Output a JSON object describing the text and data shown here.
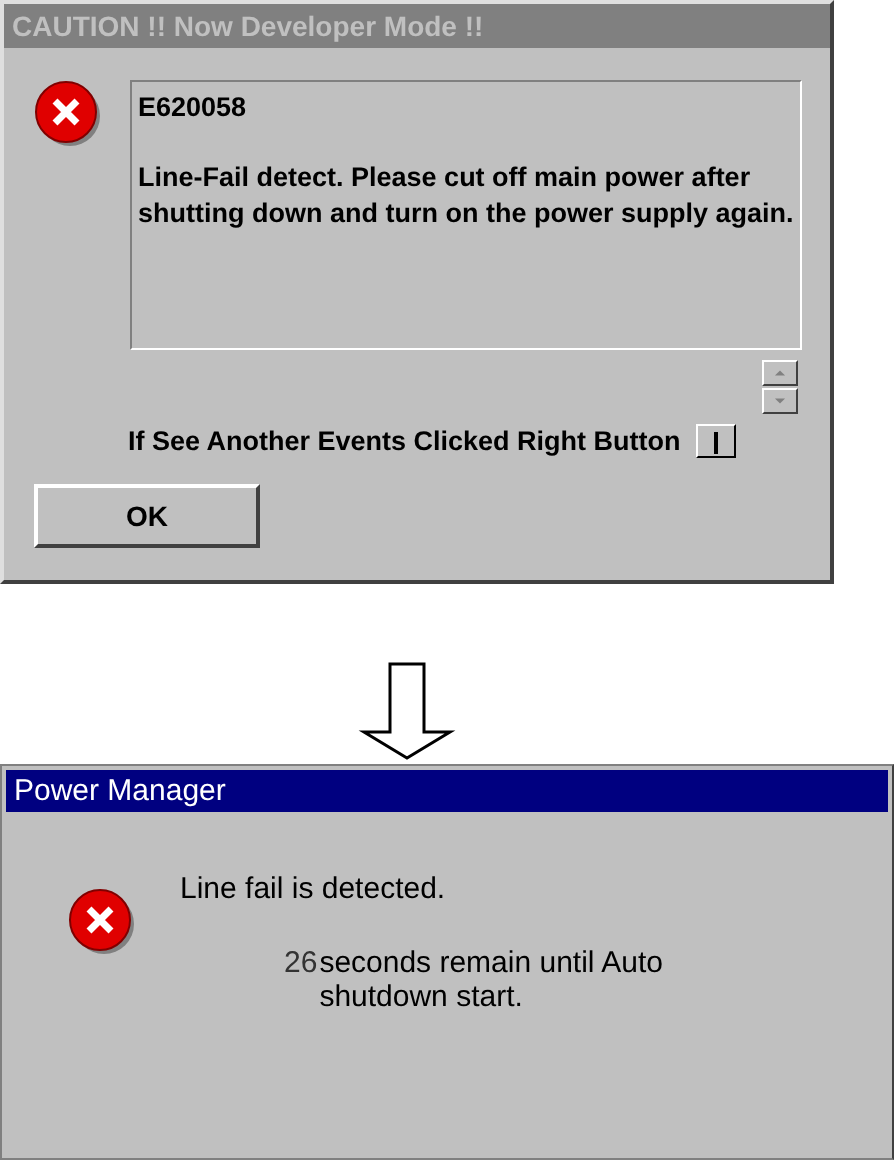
{
  "caution_dialog": {
    "title": "CAUTION !! Now Developer Mode !!",
    "active": false,
    "error_code": "E620058",
    "message": "Line-Fail detect. Please cut off main power after shutting down and turn on the power supply again.",
    "hint": "If See Another Events Clicked Right Button",
    "ok_button": "OK"
  },
  "power_manager_dialog": {
    "title": "Power Manager",
    "active": true,
    "message": "Line fail is detected.",
    "countdown": "26",
    "countdown_message": "seconds remain until Auto shutdown start."
  }
}
